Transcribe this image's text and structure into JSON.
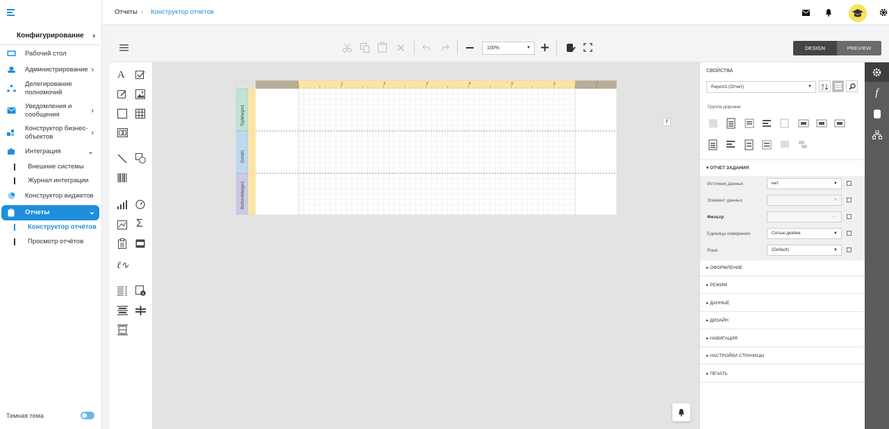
{
  "sidebar": {
    "section_title": "Конфигурирование",
    "items": [
      {
        "label": "Рабочий стол"
      },
      {
        "label": "Администрирование"
      },
      {
        "label": "Делегирование полномочий"
      },
      {
        "label": "Уведомления и сообщения"
      },
      {
        "label": "Конструктор бизнес-объектов"
      },
      {
        "label": "Интеграция"
      },
      {
        "label": "Внешние системы"
      },
      {
        "label": "Журнал интеграции"
      },
      {
        "label": "Конструктор виджетов"
      },
      {
        "label": "Отчеты"
      },
      {
        "label": "Конструктор отчётов"
      },
      {
        "label": "Просмотр отчётов"
      }
    ],
    "dark_theme_label": "Темная тема"
  },
  "header": {
    "breadcrumb_root": "Отчеты",
    "breadcrumb_sep": "›",
    "breadcrumb_current": "Конструктор отчётов"
  },
  "toolbar": {
    "zoom": "100%",
    "design_label": "DESIGN",
    "preview_label": "PREVIEW"
  },
  "report": {
    "bands": [
      "TopMargin1",
      "Detail1",
      "BottomMargin1"
    ],
    "ruler_marks": [
      "1",
      "2",
      "3",
      "4",
      "5",
      "6",
      "7"
    ]
  },
  "properties": {
    "title": "СВОЙСТВА",
    "selected_object": "Report1 (Отчет)",
    "group_label": "Группа дорожек",
    "open_section": "ОТЧЕТ ЗАДАНИЯ",
    "rows": [
      {
        "label": "Источник данных",
        "value": "нет"
      },
      {
        "label": "Элемент данных",
        "value": ""
      },
      {
        "label": "Фильтр",
        "value": "···"
      },
      {
        "label": "Единицы измерения",
        "value": "Сотые дюйма"
      },
      {
        "label": "Язык",
        "value": "(Default)"
      }
    ],
    "sections": [
      "ОФОРМЛЕНИЕ",
      "РЕЖИМ",
      "ДАННЫЕ",
      "ДИЗАЙН",
      "НАВИГАЦИЯ",
      "НАСТРОЙКИ СТРАНИЦЫ",
      "ПЕЧАТЬ"
    ]
  },
  "colors": {
    "accent": "#1d8fdb",
    "ruler": "#fce4a6",
    "top_margin_band": "#bfe3d5",
    "detail_band": "#bcd9ef",
    "bottom_margin_band": "#cbc9e6",
    "rail": "#5b5b5b"
  }
}
